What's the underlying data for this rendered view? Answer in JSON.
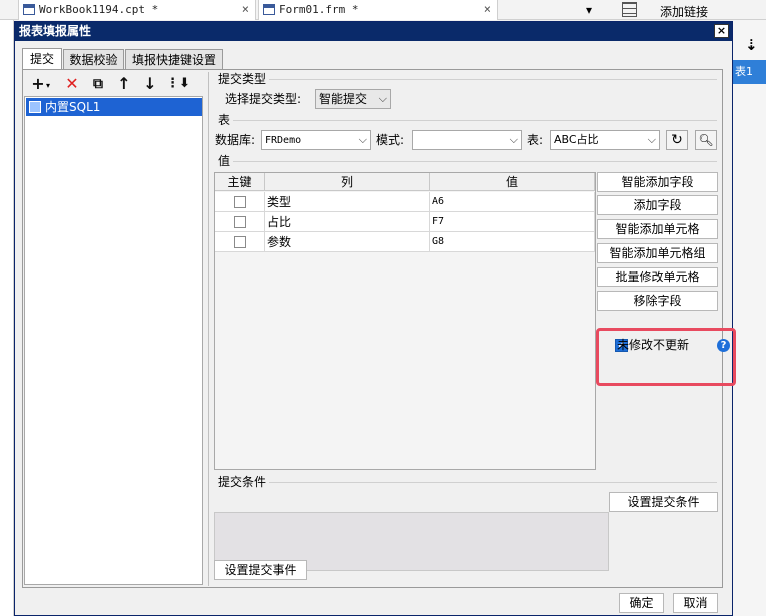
{
  "background": {
    "tabs": [
      {
        "label": "WorkBook1194.cpt *",
        "close": "×"
      },
      {
        "label": "Form01.frm *",
        "close": "×"
      }
    ],
    "right_labels": {
      "add_link": "添加链接",
      "table_item": "表1"
    }
  },
  "dialog": {
    "title": "报表填报属性",
    "close_label": "×",
    "tabs": [
      {
        "label": "提交"
      },
      {
        "label": "数据校验"
      },
      {
        "label": "填报快捷键设置"
      }
    ],
    "toolbar": {
      "add": "+",
      "delete": "✕",
      "copy": "⧉",
      "up": "↑",
      "down": "↓",
      "more": "⋮⬇"
    },
    "tree": {
      "items": [
        {
          "label": "内置SQL1"
        }
      ]
    },
    "submit_type": {
      "section_label": "提交类型",
      "field_label": "选择提交类型:",
      "value": "智能提交"
    },
    "table_section": {
      "section_label": "表",
      "database_label": "数据库:",
      "database_value": "FRDemo",
      "schema_label": "模式:",
      "schema_value": "",
      "table_label": "表:",
      "table_value": "ABC占比"
    },
    "value_section": {
      "section_label": "值",
      "columns": [
        "主键",
        "列",
        "值"
      ],
      "rows": [
        {
          "key": false,
          "column": "类型",
          "value": "A6"
        },
        {
          "key": false,
          "column": "占比",
          "value": "F7"
        },
        {
          "key": false,
          "column": "参数",
          "value": "G8"
        }
      ]
    },
    "side_buttons": [
      {
        "label": "智能添加字段"
      },
      {
        "label": "添加字段"
      },
      {
        "label": "智能添加单元格"
      },
      {
        "label": "智能添加单元格组"
      },
      {
        "label": "批量修改单元格"
      },
      {
        "label": "移除字段"
      }
    ],
    "no_update_checkbox": {
      "label": "未修改不更新",
      "checked": true,
      "help": "?"
    },
    "submit_condition": {
      "section_label": "提交条件",
      "button_label": "设置提交条件"
    },
    "event_button_label": "设置提交事件",
    "ok_label": "确定",
    "cancel_label": "取消",
    "colors": {
      "highlight": "#e84a5f",
      "accent": "#1e6fd9",
      "title_bar": "#0a2a6a"
    }
  }
}
